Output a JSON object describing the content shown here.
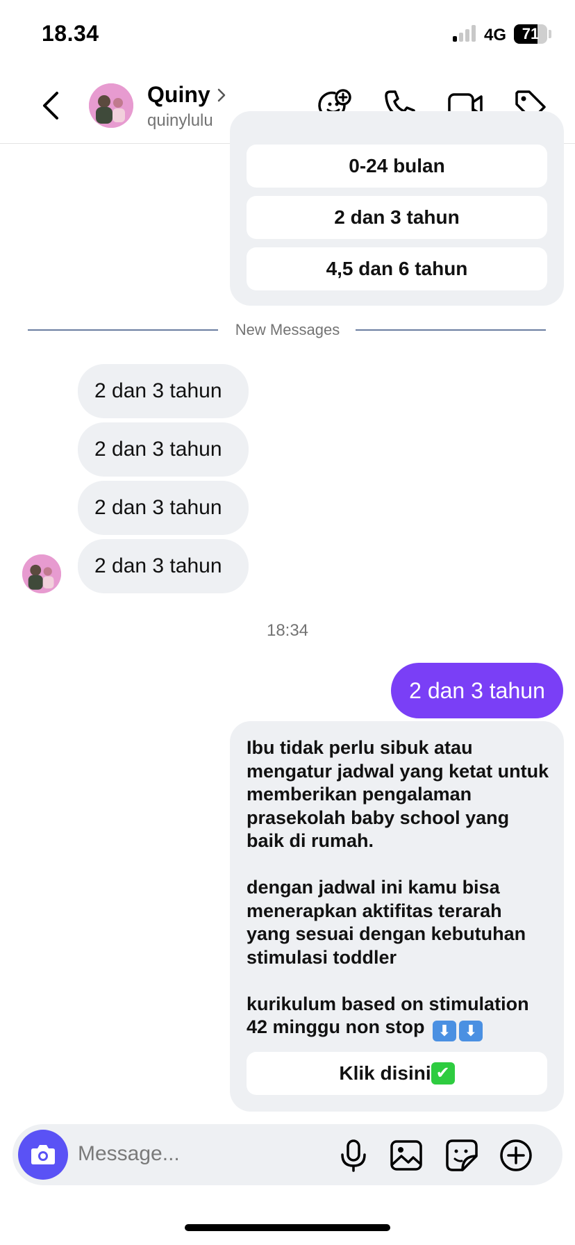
{
  "status_bar": {
    "time": "18.34",
    "network": "4G",
    "battery_level": "71",
    "battery_fraction": 0.71
  },
  "header": {
    "name": "Quiny",
    "username": "quinylulu",
    "icons": [
      "back-icon",
      "chevron-right-icon",
      "add-sticker-icon",
      "phone-icon",
      "video-camera-icon",
      "tag-icon"
    ]
  },
  "template_card": {
    "options": [
      "0-24 bulan",
      "2 dan 3 tahun",
      "4,5 dan 6 tahun"
    ]
  },
  "divider": {
    "label": "New Messages"
  },
  "incoming": [
    {
      "text": "2 dan 3 tahun"
    },
    {
      "text": "2 dan 3 tahun"
    },
    {
      "text": "2 dan 3 tahun"
    },
    {
      "text": "2 dan 3 tahun"
    }
  ],
  "timestamp": "18:34",
  "outgoing": {
    "text": "2 dan 3 tahun"
  },
  "reply_card": {
    "paragraph_1": "Ibu tidak perlu sibuk atau mengatur jadwal yang ketat untuk memberikan pengalaman prasekolah baby school yang baik di rumah.",
    "paragraph_2": "dengan jadwal ini kamu bisa menerapkan aktifitas terarah yang sesuai dengan kebutuhan stimulasi toddler",
    "paragraph_3": "kurikulum based on stimulation 42 minggu non stop",
    "arrow_emoji": "⬇",
    "button_label": "Klik disini",
    "check_emoji": "✔"
  },
  "composer": {
    "placeholder": "Message...",
    "icons": [
      "camera-icon",
      "microphone-icon",
      "gallery-icon",
      "sticker-icon",
      "plus-circle-icon"
    ]
  },
  "colors": {
    "accent_purple": "#7a3ff6",
    "camera_button": "#5a52f5",
    "bubble_gray": "#eef0f3",
    "divider_line": "#6a7da0"
  }
}
